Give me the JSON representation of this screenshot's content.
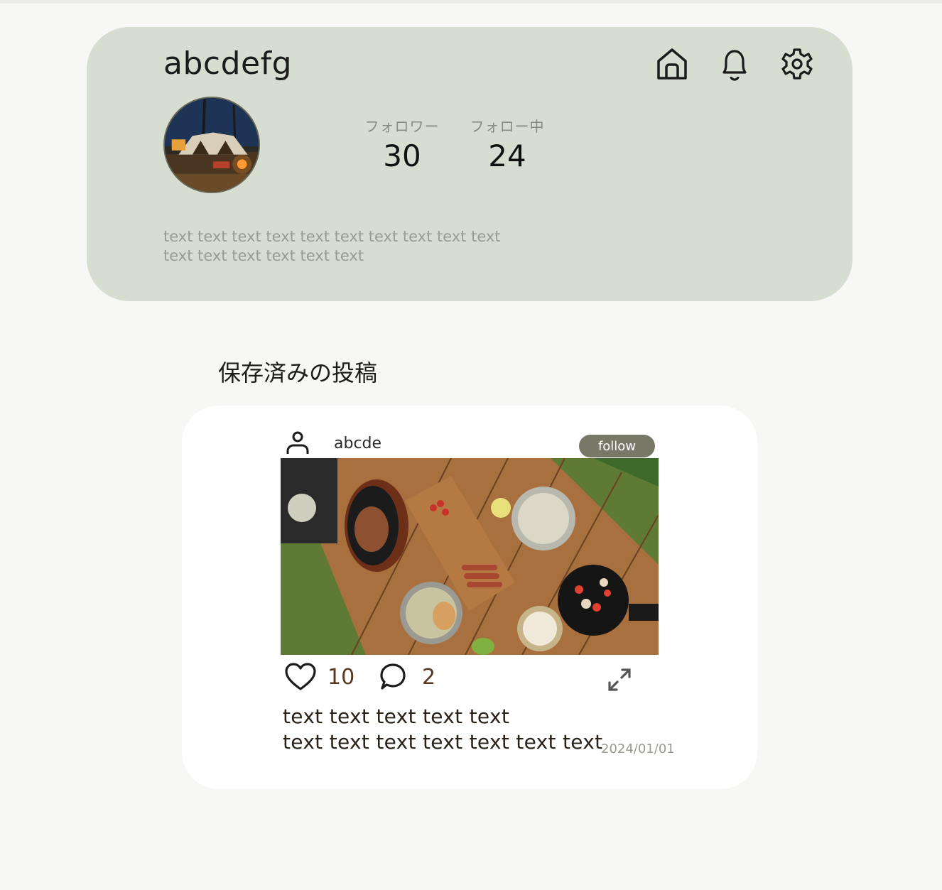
{
  "profile": {
    "username": "abcdefg",
    "followers_label": "フォロワー",
    "followers_count": "30",
    "following_label": "フォロー中",
    "following_count": "24",
    "bio_lines": [
      "text text text text text text text text text text",
      "text text text text text text"
    ],
    "avatar_icon": "camping-tent-night-photo"
  },
  "nav": {
    "icons": [
      "home-icon",
      "bell-icon",
      "gear-icon"
    ]
  },
  "section": {
    "title": "保存済みの投稿"
  },
  "post": {
    "username": "abcde",
    "follow_label": "follow",
    "image": "outdoor-table-food-photo",
    "likes": "10",
    "comments": "2",
    "caption_lines": [
      "text text text text text",
      "text text text text text text text"
    ],
    "date": "2024/01/01"
  },
  "colors": {
    "profile_card_bg": "#d8ddd2",
    "follow_button_bg": "#787868",
    "count_color": "#5a3822"
  }
}
